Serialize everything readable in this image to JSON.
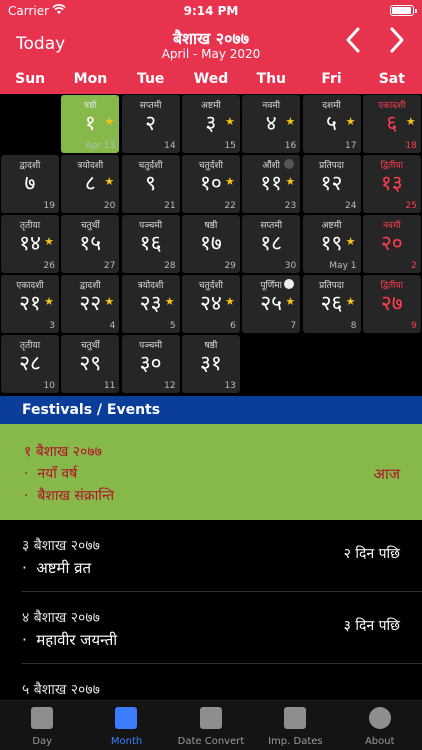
{
  "status_bar": {
    "carrier": "Carrier",
    "time": "9:14 PM"
  },
  "header": {
    "today_label": "Today",
    "month_title": "बैशाख २०७७",
    "month_subtitle": "April - May 2020",
    "prev_icon": "‹",
    "next_icon": "›"
  },
  "weekdays": [
    "Sun",
    "Mon",
    "Tue",
    "Wed",
    "Thu",
    "Fri",
    "Sat"
  ],
  "calendar": {
    "cells": [
      {
        "tithi": "षष्ठी",
        "day": "१",
        "greg": "Apr 13",
        "star": true,
        "today": true
      },
      {
        "tithi": "सप्तमी",
        "day": "२",
        "greg": "14"
      },
      {
        "tithi": "अष्टमी",
        "day": "३",
        "greg": "15",
        "star": true
      },
      {
        "tithi": "नवमी",
        "day": "४",
        "greg": "16",
        "star": true
      },
      {
        "tithi": "दशमी",
        "day": "५",
        "greg": "17",
        "star": true
      },
      {
        "tithi": "एकादशी",
        "day": "६",
        "greg": "18",
        "star": true,
        "holiday": true
      },
      {
        "tithi": "द्वादशी",
        "day": "७",
        "greg": "19"
      },
      {
        "tithi": "त्रयोदशी",
        "day": "८",
        "greg": "20",
        "star": true
      },
      {
        "tithi": "चतुर्दशी",
        "day": "९",
        "greg": "21"
      },
      {
        "tithi": "चतुर्दशी",
        "day": "१०",
        "greg": "22",
        "star": true
      },
      {
        "tithi": "औंशी",
        "day": "११",
        "greg": "23",
        "star": true,
        "moon": "new"
      },
      {
        "tithi": "प्रतिपदा",
        "day": "१२",
        "greg": "24"
      },
      {
        "tithi": "द्वितीया",
        "day": "१३",
        "greg": "25",
        "holiday": true
      },
      {
        "tithi": "तृतीया",
        "day": "१४",
        "greg": "26",
        "star": true
      },
      {
        "tithi": "चतुर्थी",
        "day": "१५",
        "greg": "27"
      },
      {
        "tithi": "पञ्चमी",
        "day": "१६",
        "greg": "28"
      },
      {
        "tithi": "षष्ठी",
        "day": "१७",
        "greg": "29"
      },
      {
        "tithi": "सप्तमी",
        "day": "१८",
        "greg": "30"
      },
      {
        "tithi": "अष्टमी",
        "day": "१९",
        "greg": "May 1",
        "star": true
      },
      {
        "tithi": "नवमी",
        "day": "२०",
        "greg": "2",
        "holiday": true
      },
      {
        "tithi": "एकादशी",
        "day": "२१",
        "greg": "3",
        "star": true
      },
      {
        "tithi": "द्वादशी",
        "day": "२२",
        "greg": "4",
        "star": true
      },
      {
        "tithi": "त्रयोदशी",
        "day": "२३",
        "greg": "5",
        "star": true
      },
      {
        "tithi": "चतुर्दशी",
        "day": "२४",
        "greg": "6",
        "star": true
      },
      {
        "tithi": "पूर्णिमा",
        "day": "२५",
        "greg": "7",
        "star": true,
        "moon": "full"
      },
      {
        "tithi": "प्रतिपदा",
        "day": "२६",
        "greg": "8",
        "star": true
      },
      {
        "tithi": "द्वितीया",
        "day": "२७",
        "greg": "9",
        "holiday": true
      },
      {
        "tithi": "तृतीया",
        "day": "२८",
        "greg": "10"
      },
      {
        "tithi": "चतुर्थी",
        "day": "२९",
        "greg": "11"
      },
      {
        "tithi": "पञ्चमी",
        "day": "३०",
        "greg": "12"
      },
      {
        "tithi": "षष्ठी",
        "day": "३१",
        "greg": "13"
      }
    ]
  },
  "events": {
    "header": "Festivals / Events",
    "today": {
      "date": "१ बैशाख २०७७",
      "items": [
        "नयाँ वर्ष",
        "बैशाख संक्रान्ति"
      ],
      "relative": "आज"
    },
    "list": [
      {
        "date": "३ बैशाख २०७७",
        "item": "अष्टमी व्रत",
        "relative": "२ दिन पछि"
      },
      {
        "date": "४ बैशाख २०७७",
        "item": "महावीर जयन्ती",
        "relative": "३ दिन पछि"
      },
      {
        "date": "५ बैशाख २०७७",
        "item": "",
        "relative": ""
      }
    ]
  },
  "tabs": [
    {
      "label": "Day",
      "icon": "day-calendar-icon"
    },
    {
      "label": "Month",
      "icon": "month-calendar-icon",
      "active": true
    },
    {
      "label": "Date Convert",
      "icon": "date-convert-icon"
    },
    {
      "label": "Imp. Dates",
      "icon": "star-calendar-icon"
    },
    {
      "label": "About",
      "icon": "info-icon"
    }
  ],
  "colors": {
    "accent": "#e8334f",
    "today": "#86b84a",
    "events_header": "#0b3e9a",
    "holiday_text": "#ff3d4f",
    "star": "#f5c518",
    "tab_active": "#3c7dff"
  }
}
